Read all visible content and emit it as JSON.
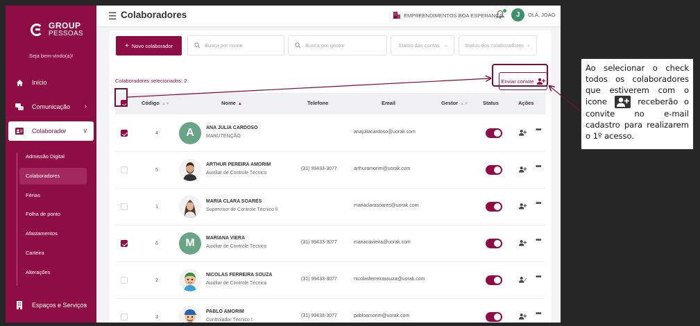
{
  "sidebar": {
    "logo_top": "GROUP",
    "logo_bottom": "PESSOAS",
    "welcome": "Seja bem-vindo(a)!",
    "items": [
      {
        "label": "Início"
      },
      {
        "label": "Comunicação"
      },
      {
        "label": "Colaborador"
      },
      {
        "label": "Espaços e Serviços"
      }
    ],
    "sub_items": [
      {
        "label": "Admissão Digital"
      },
      {
        "label": "Colaboradores"
      },
      {
        "label": "Férias"
      },
      {
        "label": "Folha de ponto"
      },
      {
        "label": "Afastamentos"
      },
      {
        "label": "Carteira"
      },
      {
        "label": "Alterações"
      }
    ]
  },
  "header": {
    "title": "Colaboradores",
    "company": "EMPREENDIMENTOS BOA ESPERANÇA",
    "avatar_letter": "J",
    "greeting": "OLÁ, JOAO"
  },
  "toolbar": {
    "new_label": "Novo colaborador",
    "search_name_placeholder": "Busca por nome",
    "search_manager_placeholder": "Busca por gestor",
    "account_status": "Status das contas",
    "employee_status": "Status dos colaboradores"
  },
  "selection": {
    "count_text": "Colaboradores selecionados: 2",
    "invite_label": "Enviar convite"
  },
  "table": {
    "headers": {
      "code": "Código",
      "name": "Nome",
      "phone": "Telefone",
      "email": "Email",
      "manager": "Gestor",
      "status": "Status",
      "actions": "Ações"
    },
    "rows": [
      {
        "code": "4",
        "initial": "A",
        "name": "ANA JULIA CARDOSO",
        "role": "MANUTENÇÃO",
        "phone": "",
        "email": "anajuliacardoso@uorak.com",
        "checked": true
      },
      {
        "code": "5",
        "initial": "",
        "name": "ARTHUR PEREIRA AMORIM",
        "role": "Auxiliar de Controle Técnico",
        "phone": "(31) 99433-3077",
        "email": "arthuramorim@uorak.com",
        "checked": false
      },
      {
        "code": "1",
        "initial": "",
        "name": "MARIA CLARA SOARES",
        "role": "Supervisor de Controle Técnico II",
        "phone": "",
        "email": "mariaclarasoares@uorak.com",
        "checked": false
      },
      {
        "code": "6",
        "initial": "M",
        "name": "MARIANA VIERA",
        "role": "Auxiliar de Controle Técnico",
        "phone": "(31) 99433-3077",
        "email": "marianavieira@uorak.com",
        "checked": true
      },
      {
        "code": "2",
        "initial": "",
        "name": "NICOLAS FERREIRA SOUZA",
        "role": "Auxiliar de Controle Técnico",
        "phone": "(31) 99433-3077",
        "email": "nicolasferreirasouza@uorak.com",
        "checked": false
      },
      {
        "code": "3",
        "initial": "",
        "name": "PABLO AMORIM",
        "role": "Controlador Técnico I",
        "phone": "(31) 99433-3077",
        "email": "pabloamorim@uorak.com",
        "checked": false
      }
    ]
  },
  "note": {
    "part1": "Ao selecionar o check todos os colaboradores que estiverem com o icone",
    "part2": "receberão o convite no e-mail cadastro para realizarem o 1º acesso."
  },
  "colors": {
    "brand": "#8f0d45",
    "sidebar": "#8f0d45",
    "accent_green": "#2fa84f"
  }
}
